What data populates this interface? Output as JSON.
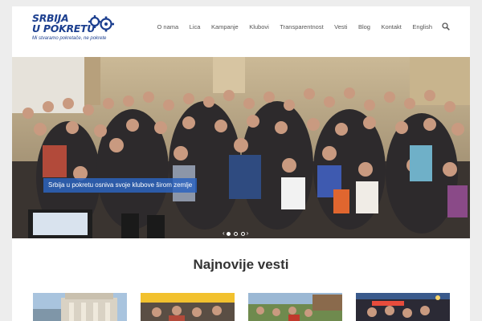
{
  "logo": {
    "line1": "SRBIJA",
    "line2": "U POKRETU",
    "tagline": "Mi stvaramo pokretače, ne pokrete",
    "brand_color": "#1c3f8f"
  },
  "nav": {
    "items": [
      {
        "label": "O nama"
      },
      {
        "label": "Lica"
      },
      {
        "label": "Kampanje"
      },
      {
        "label": "Klubovi"
      },
      {
        "label": "Transparentnost"
      },
      {
        "label": "Vesti"
      },
      {
        "label": "Blog"
      },
      {
        "label": "Kontakt"
      },
      {
        "label": "English"
      }
    ],
    "search_icon": "search-icon"
  },
  "slider": {
    "caption": "Srbija u pokretu osniva svoje klubove širom zemlje",
    "prev_icon": "chevron-left-icon",
    "next_icon": "chevron-right-icon",
    "slide_count": 3,
    "active_slide": 1
  },
  "news": {
    "title": "Najnovije vesti"
  },
  "colors": {
    "accent": "#2d64be",
    "text": "#333333",
    "page_bg": "#ededed"
  }
}
